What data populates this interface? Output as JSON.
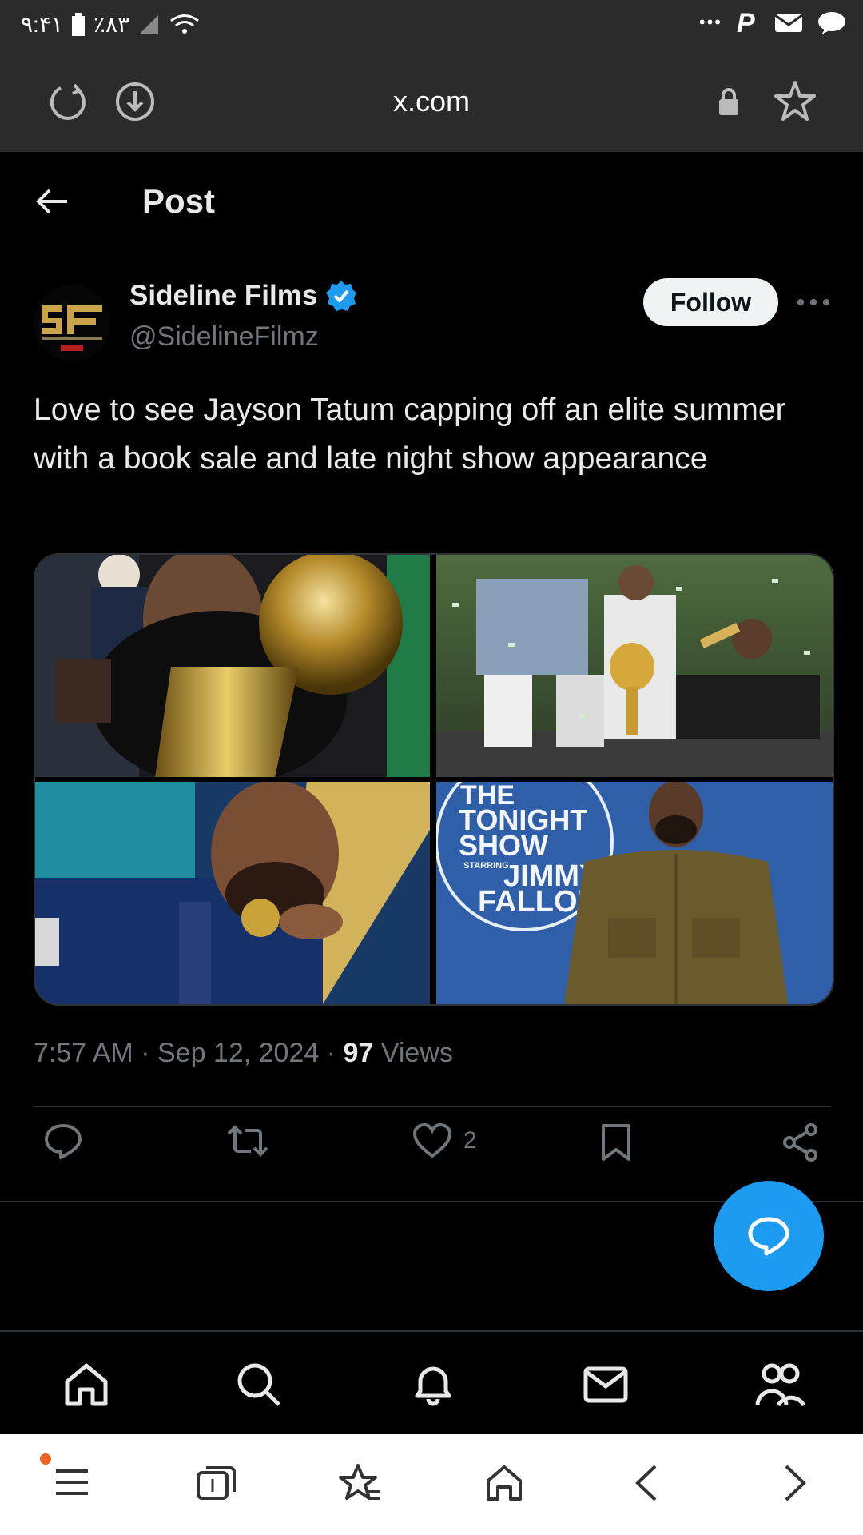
{
  "status_bar": {
    "time": "۹:۴۱",
    "battery": "٪۸۳",
    "more": "•••"
  },
  "browser": {
    "url": "x.com"
  },
  "header": {
    "title": "Post"
  },
  "post": {
    "author_name": "Sideline Films",
    "handle": "@SidelineFilmz",
    "follow_label": "Follow",
    "text": "Love to see Jayson Tatum capping off an elite summer with a book sale and late night show appearance",
    "time": "7:57 AM",
    "date": "Sep 12, 2024",
    "views_count": "97",
    "views_label": "Views",
    "likes": "2",
    "media": {
      "tonight_line1": "THE",
      "tonight_line2": "TONIGHT",
      "tonight_line3": "SHOW",
      "starring": "STARRING",
      "host1": "JIMMY",
      "host2": "FALLON"
    }
  },
  "colors": {
    "accent": "#1d9bf0",
    "background": "#000000",
    "muted": "#71767b"
  }
}
